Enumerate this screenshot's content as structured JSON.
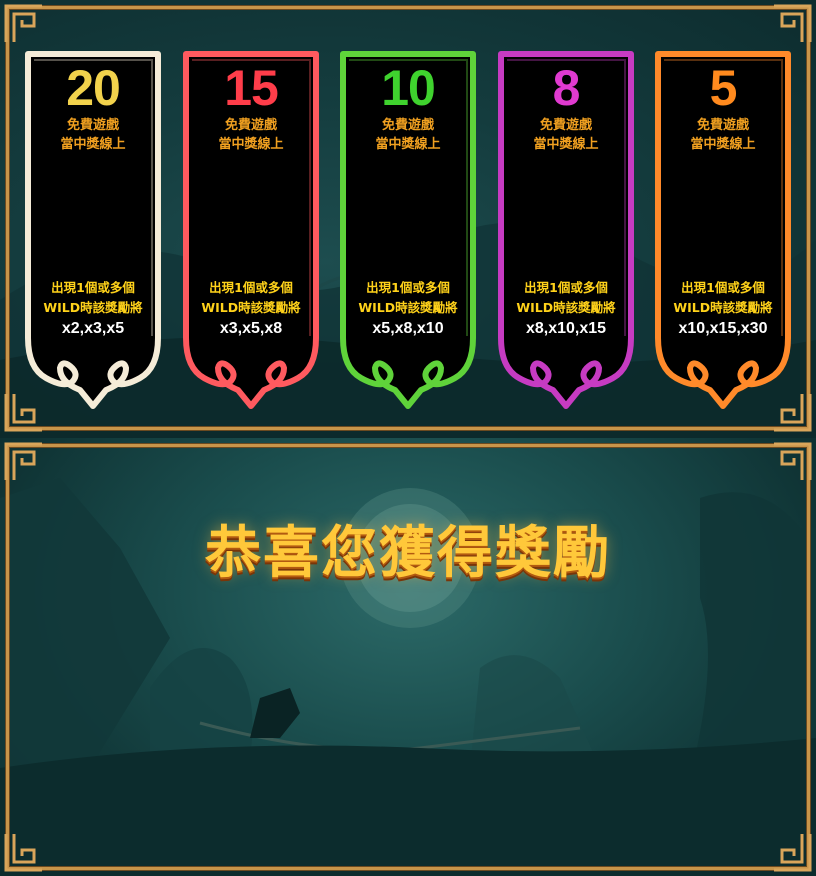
{
  "top_panel": {
    "banners": [
      {
        "count": "20",
        "line1": "免費遊戲",
        "line2": "當中獎線上",
        "cond1": "出現1個或多個",
        "cond2": "WILD時該獎勵將",
        "multipliers": "x2,x3,x5",
        "theme": "white",
        "count_color": "#f2d24c",
        "border_color": "#f5ecd8"
      },
      {
        "count": "15",
        "line1": "免費遊戲",
        "line2": "當中獎線上",
        "cond1": "出現1個或多個",
        "cond2": "WILD時該獎勵將",
        "multipliers": "x3,x5,x8",
        "theme": "red",
        "count_color": "#ff3d4a",
        "border_color": "#ff5a5f"
      },
      {
        "count": "10",
        "line1": "免費遊戲",
        "line2": "當中獎線上",
        "cond1": "出現1個或多個",
        "cond2": "WILD時該獎勵將",
        "multipliers": "x5,x8,x10",
        "theme": "green",
        "count_color": "#3fd22e",
        "border_color": "#5fd33a"
      },
      {
        "count": "8",
        "line1": "免費遊戲",
        "line2": "當中獎線上",
        "cond1": "出現1個或多個",
        "cond2": "WILD時該獎勵將",
        "multipliers": "x8,x10,x15",
        "theme": "purple",
        "count_color": "#e03ad0",
        "border_color": "#c63bc2"
      },
      {
        "count": "5",
        "line1": "免費遊戲",
        "line2": "當中獎線上",
        "cond1": "出現1個或多個",
        "cond2": "WILD時該獎勵將",
        "multipliers": "x10,x15,x30",
        "theme": "orange",
        "count_color": "#ff8a1e",
        "border_color": "#ff8a2a"
      }
    ]
  },
  "bottom_panel": {
    "title": "恭喜您獲得獎勵"
  },
  "colors": {
    "frame_gold": "#c8954a",
    "background_teal": "#143c3e",
    "subtitle_orange": "#f0a020",
    "condition_yellow": "#ffd21a"
  }
}
